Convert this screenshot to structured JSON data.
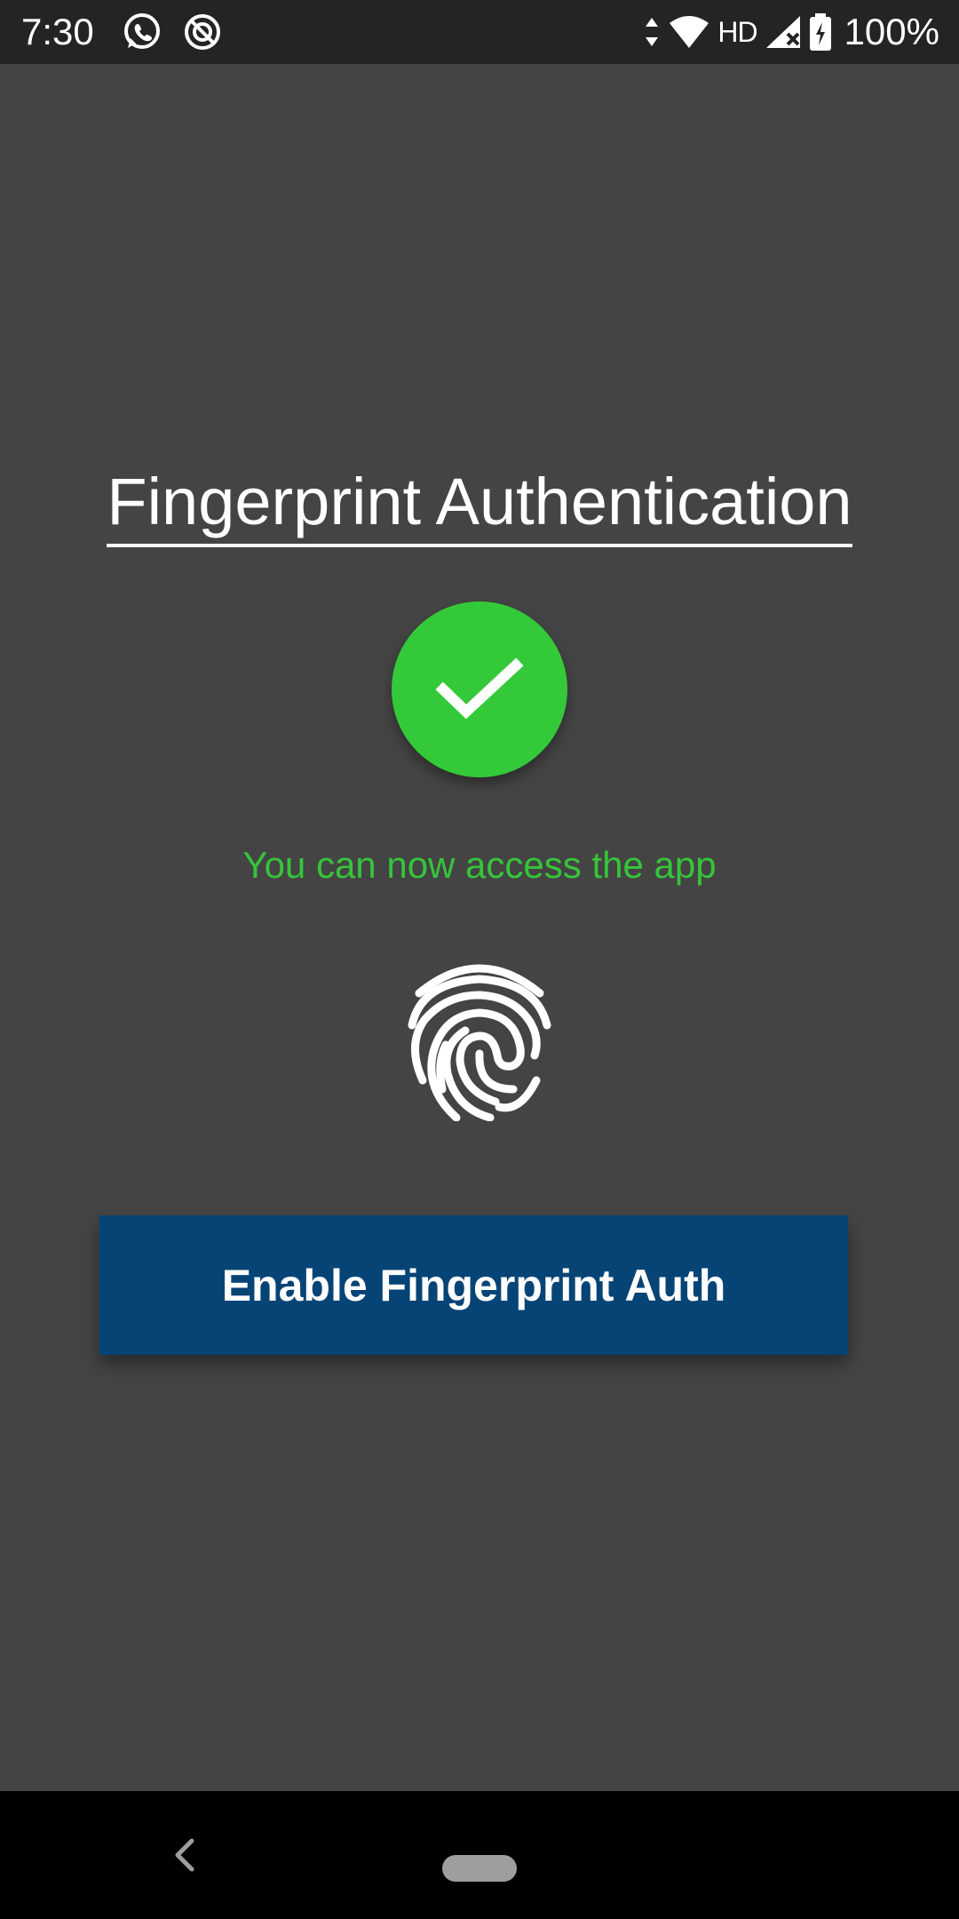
{
  "status_bar": {
    "time": "7:30",
    "left_icons": [
      "whatsapp-icon",
      "sync-off-icon"
    ],
    "network_label": "HD",
    "battery_percent": "100%",
    "right_icons": [
      "data-arrows-icon",
      "wifi-icon",
      "signal-icon",
      "battery-charging-icon"
    ]
  },
  "main": {
    "title": "Fingerprint Authentication",
    "status_icon": "check-icon",
    "status_color": "#33c938",
    "message": "You can now access the app",
    "message_color": "#35c53a",
    "fingerprint_icon": "fingerprint-icon",
    "button_label": "Enable Fingerprint Auth",
    "button_color": "#064476"
  },
  "nav_bar": {
    "back_icon": "back-chevron-icon",
    "home_icon": "home-pill-icon"
  },
  "colors": {
    "background": "#444444",
    "status_bar": "#242424",
    "nav_bar": "#000000"
  }
}
